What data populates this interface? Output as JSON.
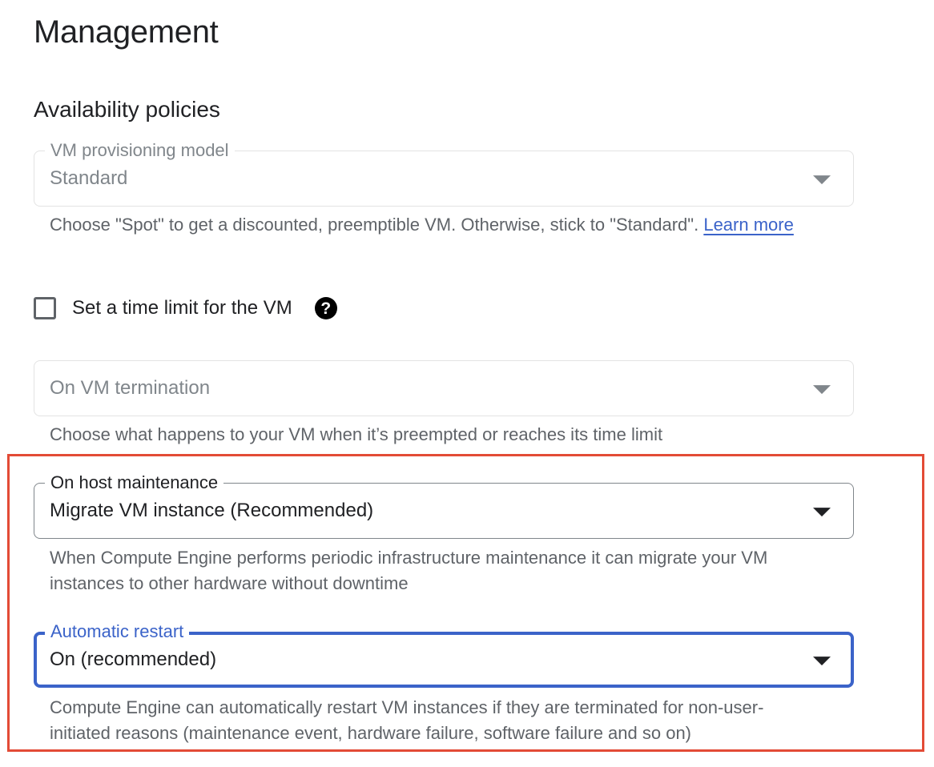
{
  "page": {
    "title": "Management",
    "section_title": "Availability policies"
  },
  "provisioning_model": {
    "label": "VM provisioning model",
    "value": "Standard",
    "helper_text": "Choose \"Spot\" to get a discounted, preemptible VM. Otherwise, stick to \"Standard\". ",
    "learn_more": "Learn more",
    "state": "disabled"
  },
  "time_limit": {
    "label": "Set a time limit for the VM",
    "checked": false,
    "help_icon": "?"
  },
  "vm_termination": {
    "placeholder": "On VM termination",
    "helper_text": "Choose what happens to your VM when it’s preempted or reaches its time limit",
    "state": "disabled"
  },
  "host_maintenance": {
    "label": "On host maintenance",
    "value": "Migrate VM instance (Recommended)",
    "helper_text": "When Compute Engine performs periodic infrastructure maintenance it can migrate your VM instances to other hardware without downtime"
  },
  "automatic_restart": {
    "label": "Automatic restart",
    "value": "On (recommended)",
    "helper_text": "Compute Engine can automatically restart VM instances if they are terminated for non-user-initiated reasons (maintenance event, hardware failure, software failure and so on)",
    "state": "focused"
  },
  "colors": {
    "accent": "#3b63c9",
    "highlight": "#e34b36",
    "disabled_text": "#80868b",
    "helper_text": "#5f6368"
  },
  "icons": {
    "dropdown": "dropdown-arrow-icon",
    "help": "help-icon"
  }
}
